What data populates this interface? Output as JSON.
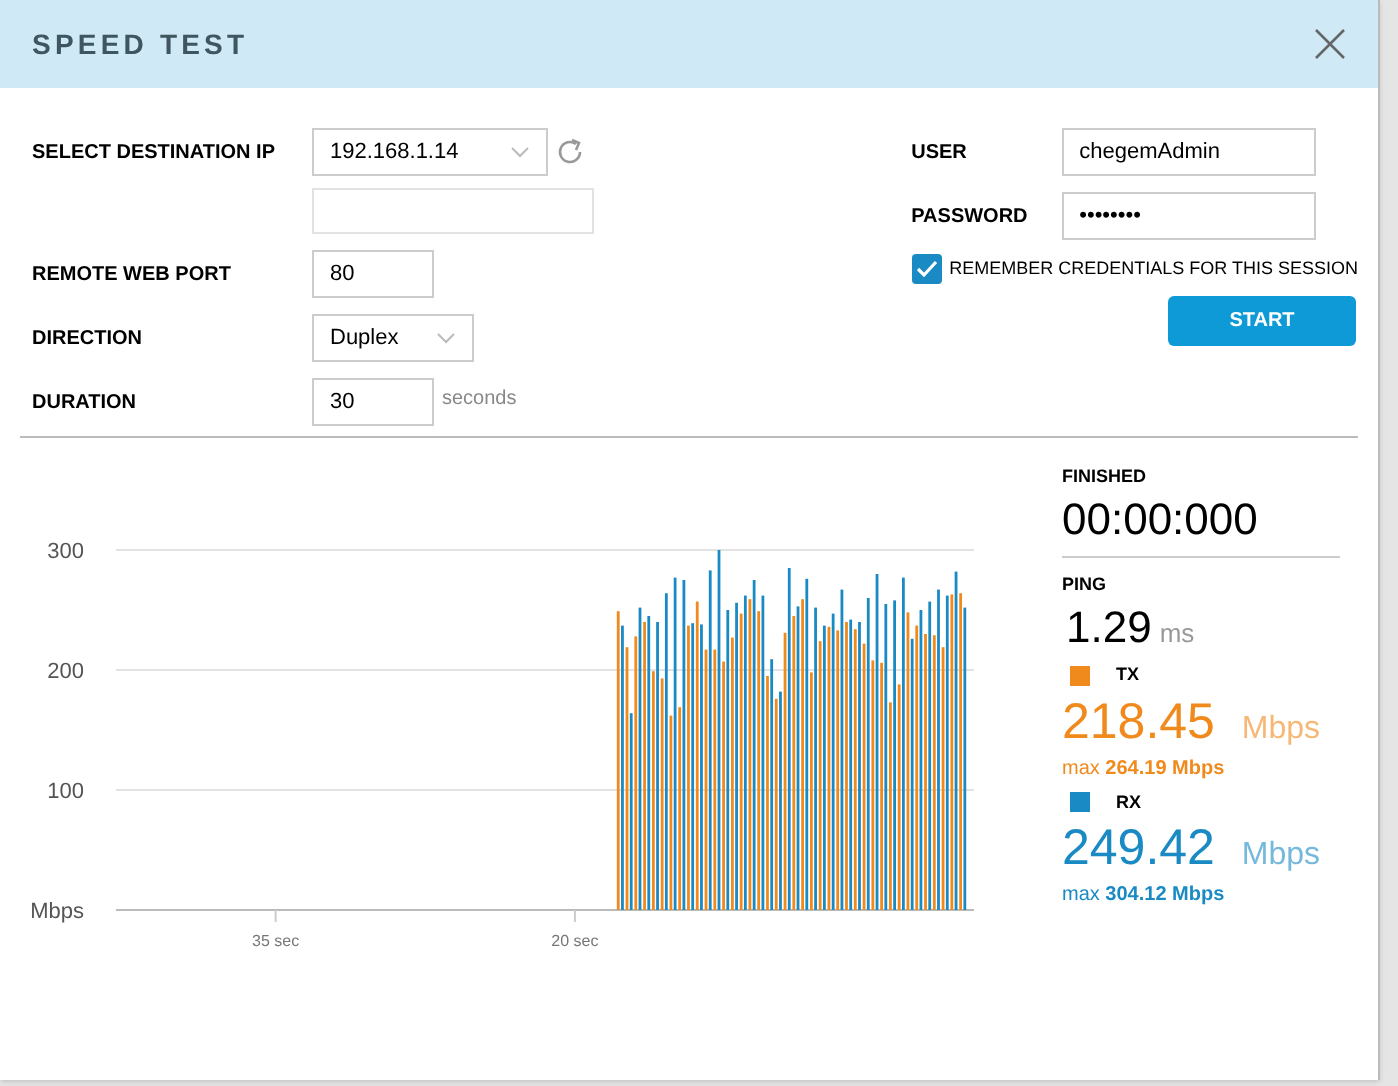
{
  "dialog": {
    "title": "SPEED TEST"
  },
  "form": {
    "destination_ip": {
      "label": "SELECT DESTINATION IP",
      "value": "192.168.1.14"
    },
    "remote_web_port": {
      "label": "REMOTE WEB PORT",
      "value": "80"
    },
    "direction": {
      "label": "DIRECTION",
      "value": "Duplex"
    },
    "duration": {
      "label": "DURATION",
      "value": "30",
      "unit": "seconds"
    },
    "user": {
      "label": "USER",
      "value": "chegemAdmin"
    },
    "password": {
      "label": "PASSWORD",
      "value": "••••••••"
    },
    "remember": {
      "label": "REMEMBER CREDENTIALS FOR THIS SESSION",
      "checked": true
    },
    "start_button": "START"
  },
  "chart": {
    "chart_data": {
      "type": "bar",
      "grid": true,
      "xlim": [
        43,
        0
      ],
      "ylim": [
        0,
        300
      ],
      "yticks": [
        {
          "value": 0,
          "label": "Mbps"
        },
        100,
        200,
        300
      ],
      "xticks": [
        {
          "value": 35,
          "label": "35 sec"
        },
        {
          "value": 20,
          "label": "20 sec"
        }
      ],
      "x": [
        17.9,
        17.46,
        17.02,
        16.58,
        16.14,
        15.7,
        15.26,
        14.82,
        14.38,
        13.94,
        13.5,
        13.06,
        12.62,
        12.18,
        11.74,
        11.3,
        10.86,
        10.42,
        9.98,
        9.54,
        9.1,
        8.66,
        8.22,
        7.78,
        7.34,
        6.9,
        6.46,
        6.02,
        5.58,
        5.14,
        4.7,
        4.26,
        3.82,
        3.38,
        2.94,
        2.5,
        2.06,
        1.62,
        1.18,
        0.74
      ],
      "series": [
        {
          "color": "#f08a1c",
          "values": [
            249,
            219,
            228,
            240,
            199,
            193,
            162,
            169,
            237,
            257,
            217,
            217,
            207,
            227,
            247,
            259,
            249,
            195,
            176,
            231,
            245,
            259,
            198,
            224,
            236,
            233,
            240,
            234,
            222,
            208,
            206,
            173,
            188,
            248,
            237,
            230,
            229,
            219,
            263,
            264
          ]
        },
        {
          "color": "#1a8ac4",
          "values": [
            237,
            164,
            252,
            245,
            240,
            264,
            277,
            275,
            239,
            238,
            283,
            300,
            250,
            256,
            262,
            275,
            262,
            209,
            182,
            285,
            253,
            276,
            252,
            237,
            247,
            267,
            242,
            240,
            260,
            280,
            255,
            258,
            277,
            226,
            250,
            257,
            267,
            262,
            282,
            252
          ]
        }
      ]
    }
  },
  "stats": {
    "status": {
      "label": "FINISHED",
      "value": "00:00:000"
    },
    "ping": {
      "label": "PING",
      "value": "1.29",
      "unit": "ms"
    },
    "series": [
      {
        "label": "TX",
        "color": "#f08a1c",
        "value": "218.45",
        "unit": "Mbps",
        "max": "max **264.19 Mbps**"
      },
      {
        "label": "RX",
        "color": "#1a8ac4",
        "value": "249.42",
        "unit": "Mbps",
        "max": "max **304.12 Mbps**"
      }
    ]
  }
}
